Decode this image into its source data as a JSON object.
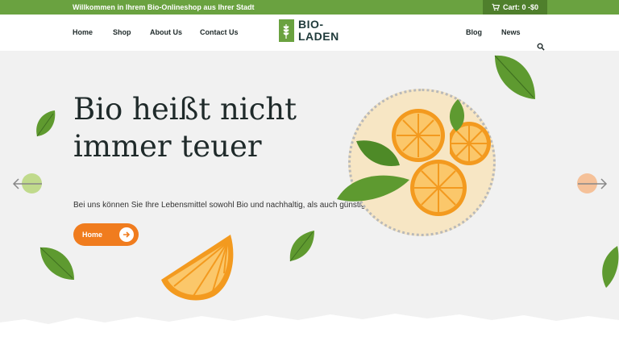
{
  "topbar": {
    "welcome": "Willkommen in Ihrem Bio-Onlineshop aus Ihrer Stadt",
    "cart": "Cart: 0 -$0",
    "cart_icon": "cart-icon"
  },
  "nav": {
    "home": "Home",
    "shop": "Shop",
    "about": "About Us",
    "contact": "Contact Us",
    "blog": "Blog",
    "news": "News",
    "search_icon": "search-icon"
  },
  "logo": {
    "line1": "BIO-",
    "line2": "LADEN"
  },
  "hero": {
    "headline": "Bio heißt nicht immer teuer",
    "subtext": "Bei uns können Sie Ihre Lebensmittel sowohl Bio und nachhaltig, als auch günstig erwerben",
    "button_label": "Home"
  },
  "colors": {
    "brand_green": "#6aa240",
    "accent_orange": "#f07c1e",
    "hero_bg": "#f1f1f1"
  }
}
